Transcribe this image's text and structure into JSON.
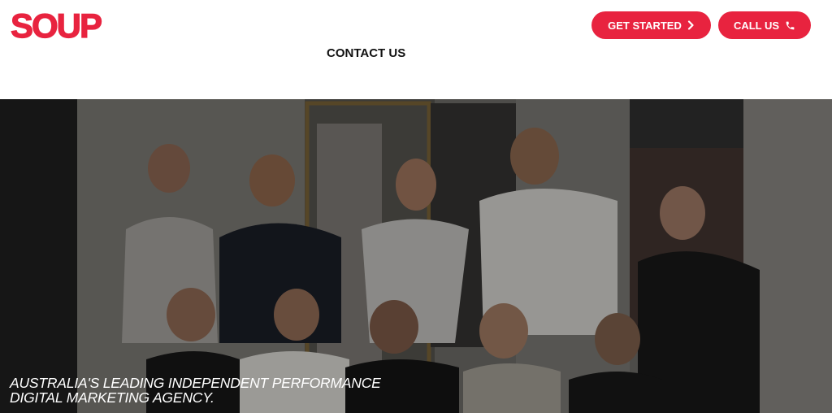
{
  "header": {
    "logo_text": "SOUP",
    "nav_link": "CONTACT US",
    "get_started_label": "GET STARTED",
    "call_us_label": "CALL US",
    "accent_color": "#e8233f"
  },
  "hero": {
    "headline_line1": "AUSTRALIA'S LEADING INDEPENDENT PERFORMANCE",
    "headline_line2": "DIGITAL MARKETING AGENCY.",
    "image_description_icon": "team-photo"
  }
}
